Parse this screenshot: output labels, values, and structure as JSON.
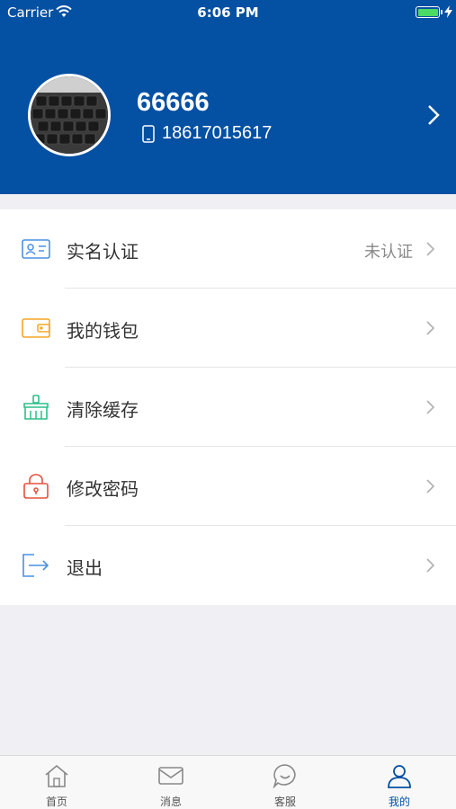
{
  "status_bar": {
    "carrier": "Carrier",
    "time": "6:06 PM"
  },
  "profile": {
    "username": "66666",
    "phone": "18617015617"
  },
  "menu": [
    {
      "label": "实名认证",
      "value": "未认证",
      "icon": "id-card-icon",
      "accent": "#4a90e2"
    },
    {
      "label": "我的钱包",
      "value": "",
      "icon": "wallet-icon",
      "accent": "#f5a623"
    },
    {
      "label": "清除缓存",
      "value": "",
      "icon": "broom-icon",
      "accent": "#2bbf8a"
    },
    {
      "label": "修改密码",
      "value": "",
      "icon": "lock-icon",
      "accent": "#e5503d"
    },
    {
      "label": "退出",
      "value": "",
      "icon": "logout-icon",
      "accent": "#4a90e2"
    }
  ],
  "tabbar": [
    {
      "label": "首页",
      "icon": "home-icon",
      "active": false
    },
    {
      "label": "消息",
      "icon": "mail-icon",
      "active": false
    },
    {
      "label": "客服",
      "icon": "chat-icon",
      "active": false
    },
    {
      "label": "我的",
      "icon": "user-icon",
      "active": true
    }
  ],
  "colors": {
    "header": "#0450a3",
    "background": "#f0f0f4",
    "active_tab": "#0450a3"
  }
}
